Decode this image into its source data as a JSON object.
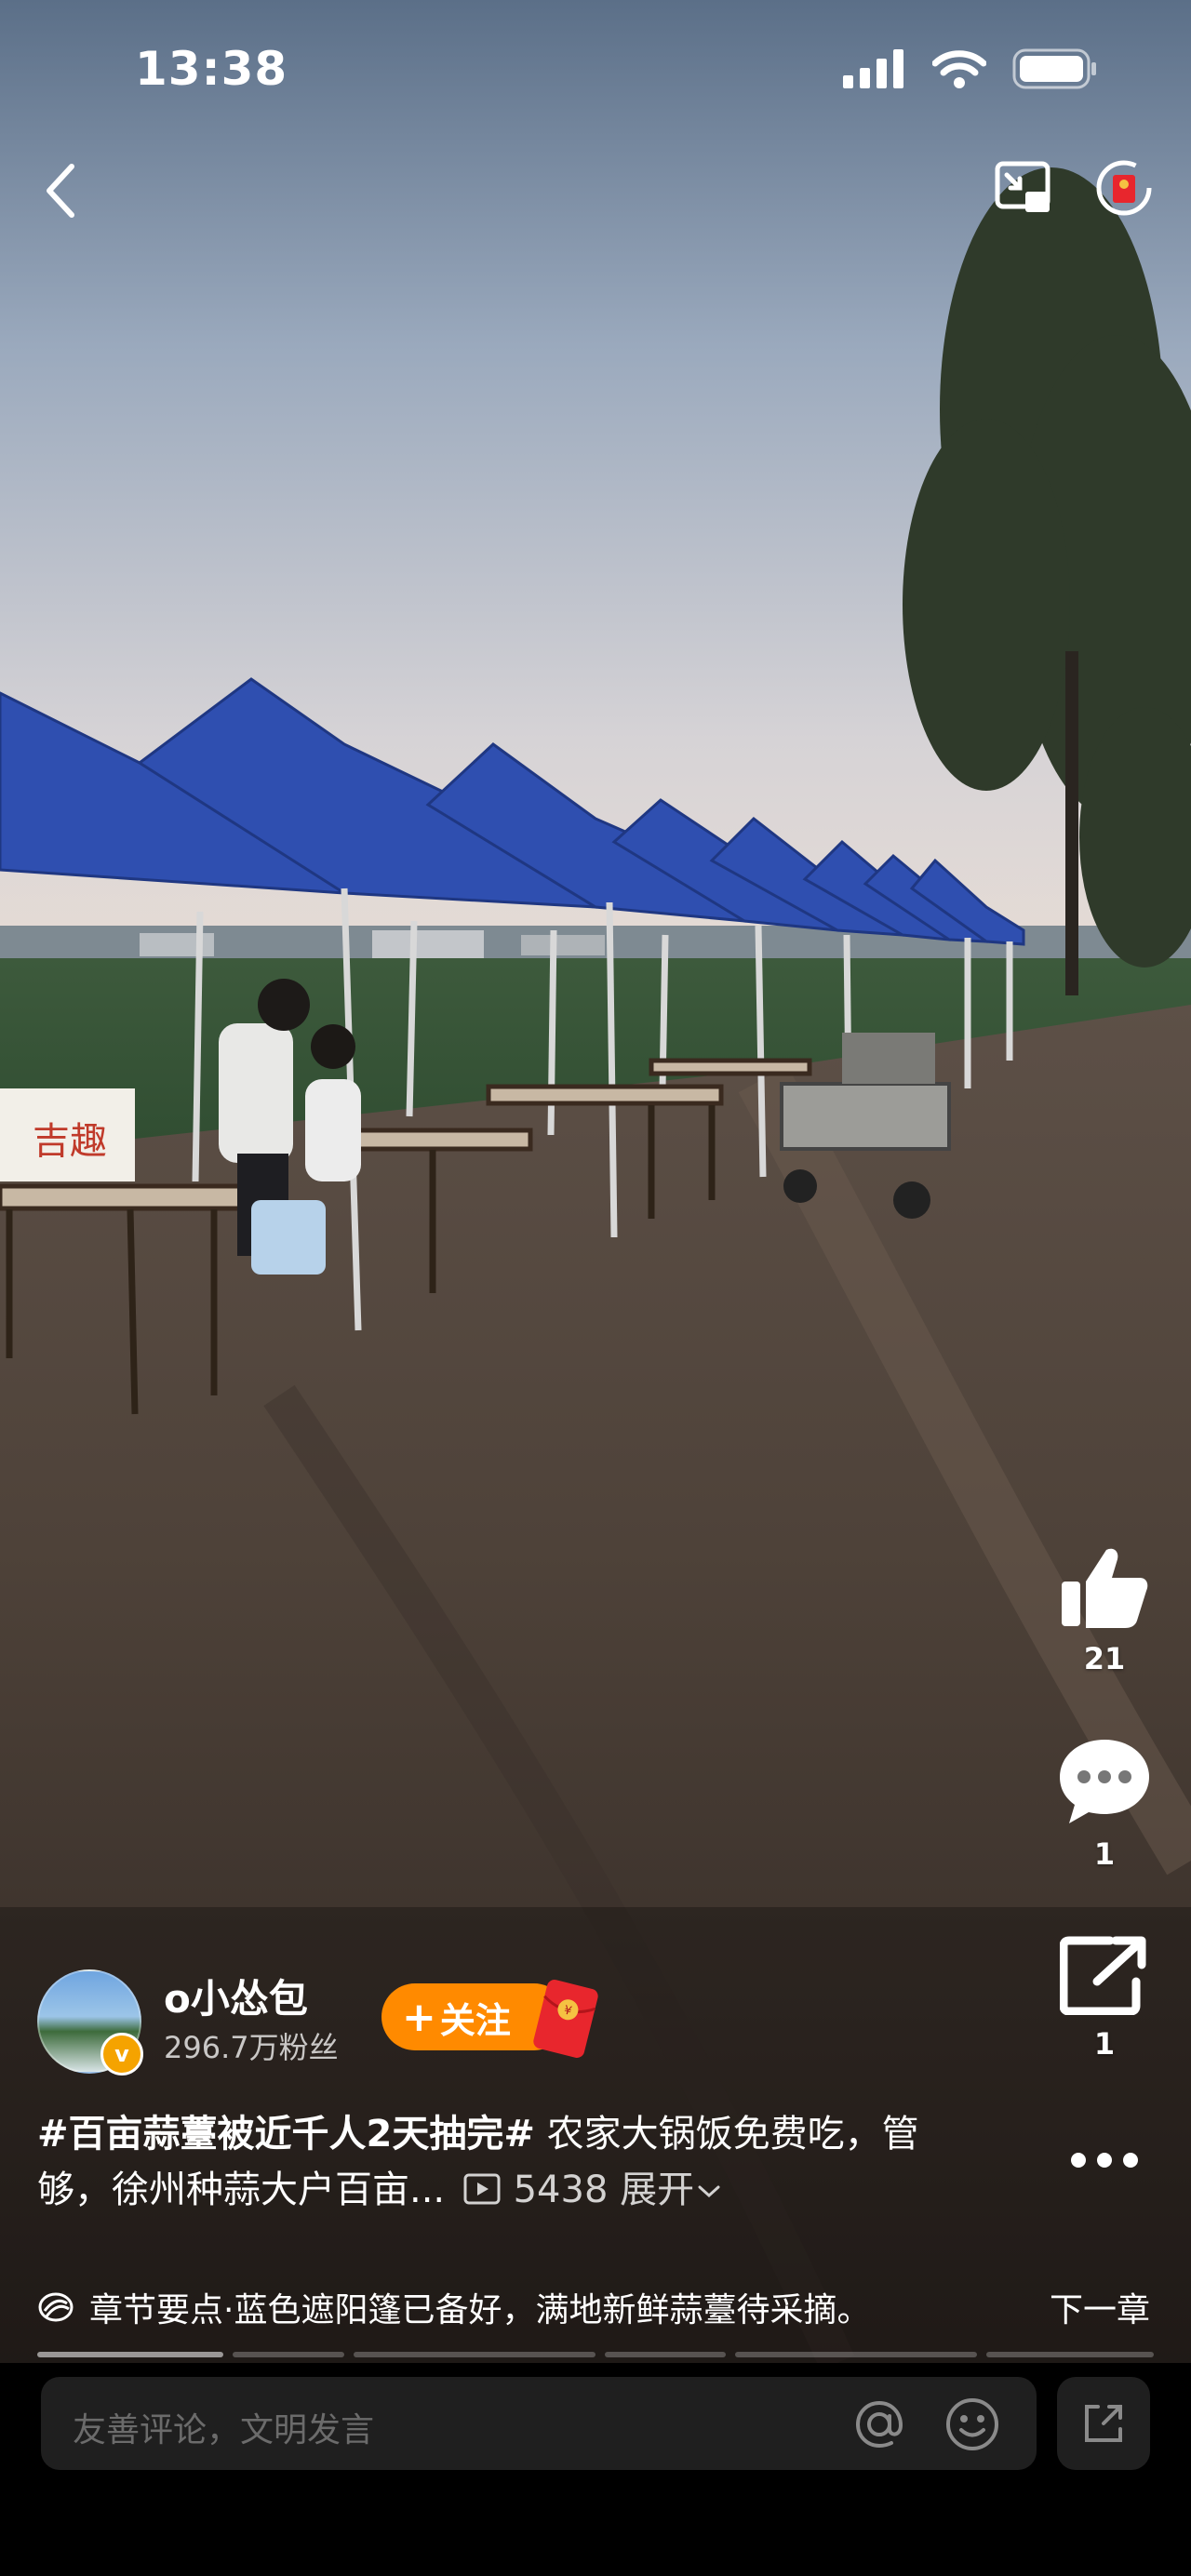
{
  "status_bar": {
    "time": "13:38"
  },
  "author": {
    "name": "o小怂包",
    "fans": "296.7万粉丝",
    "follow_label": "关注",
    "follow_plus": "+"
  },
  "actions": {
    "like_count": "21",
    "comment_count": "1",
    "share_count": "1"
  },
  "caption": {
    "hashtag": "#百亩蒜薹被近千人2天抽完#",
    "text": " 农家大锅饭免费吃，管够，徐州种蒜大户百亩...",
    "views": "5438",
    "expand": "展开"
  },
  "chapter": {
    "text": "章节要点·蓝色遮阳篷已备好，满地新鲜蒜薹待采摘。",
    "next_label": "下一章"
  },
  "comment_input": {
    "placeholder": "友善评论，文明发言"
  },
  "colors": {
    "follow": "#ff8a00",
    "redpack": "#e8262d",
    "tent": "#2f4fb0"
  }
}
